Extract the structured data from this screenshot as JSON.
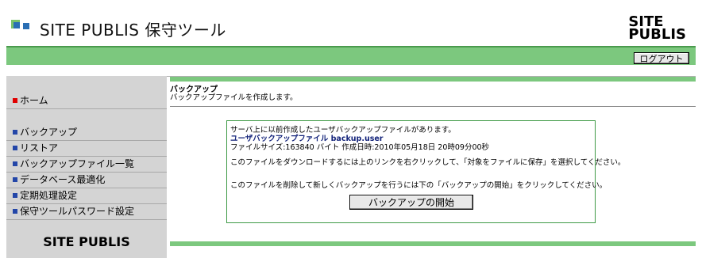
{
  "header": {
    "title": "SITE PUBLIS 保守ツール",
    "brand_line1": "SITE",
    "brand_line2": "PUBLIS",
    "logout_label": "ログアウト"
  },
  "sidebar": {
    "items": [
      {
        "label": "ホーム",
        "bullet_color": "#e00000"
      },
      {
        "label": "バックアップ",
        "bullet_color": "#2346a8"
      },
      {
        "label": "リストア",
        "bullet_color": "#2346a8"
      },
      {
        "label": "バックアップファイル一覧",
        "bullet_color": "#2346a8"
      },
      {
        "label": "データベース最適化",
        "bullet_color": "#2346a8"
      },
      {
        "label": "定期処理設定",
        "bullet_color": "#2346a8"
      },
      {
        "label": "保守ツールパスワード設定",
        "bullet_color": "#2346a8"
      }
    ],
    "footer": "SITE PUBLIS"
  },
  "main": {
    "section_title": "バックアップ",
    "section_desc": "バックアップファイルを作成します。",
    "notice": {
      "line1": "サーバ上に以前作成したユーザバックアップファイルがあります。",
      "file_link": "ユーザバックアップファイル backup.user",
      "file_info": "ファイルサイズ:163840 バイト 作成日時:2010年05月18日 20時09分00秒",
      "download_hint": "このファイルをダウンロードするには上のリンクを右クリックして、「対象をファイルに保存」を選択してください。",
      "delete_hint": "このファイルを削除して新しくバックアップを行うには下の「バックアップの開始」をクリックしてください。",
      "start_label": "バックアップの開始"
    }
  }
}
